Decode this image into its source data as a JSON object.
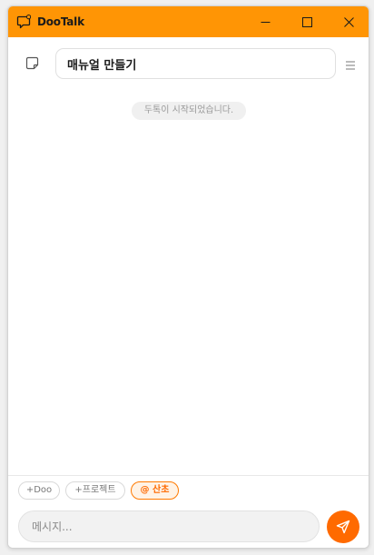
{
  "window": {
    "title": "DooTalk",
    "accent_color": "#ff9505",
    "controls": {
      "minimize_icon": "minimize-icon",
      "maximize_icon": "maximize-icon",
      "close_icon": "close-icon"
    }
  },
  "header": {
    "note_icon": "sticky-note-icon",
    "title_value": "매뉴얼 만들기",
    "menu_icon": "hamburger-menu-icon"
  },
  "chat": {
    "system_message": "두톡이 시작되었습니다."
  },
  "footer": {
    "chips": [
      {
        "label": "+Doo"
      },
      {
        "label": "+프로젝트"
      },
      {
        "label": "@ 산초"
      }
    ],
    "message_placeholder": "메시지...",
    "send_icon": "send-icon",
    "send_color": "#ff6a00"
  }
}
